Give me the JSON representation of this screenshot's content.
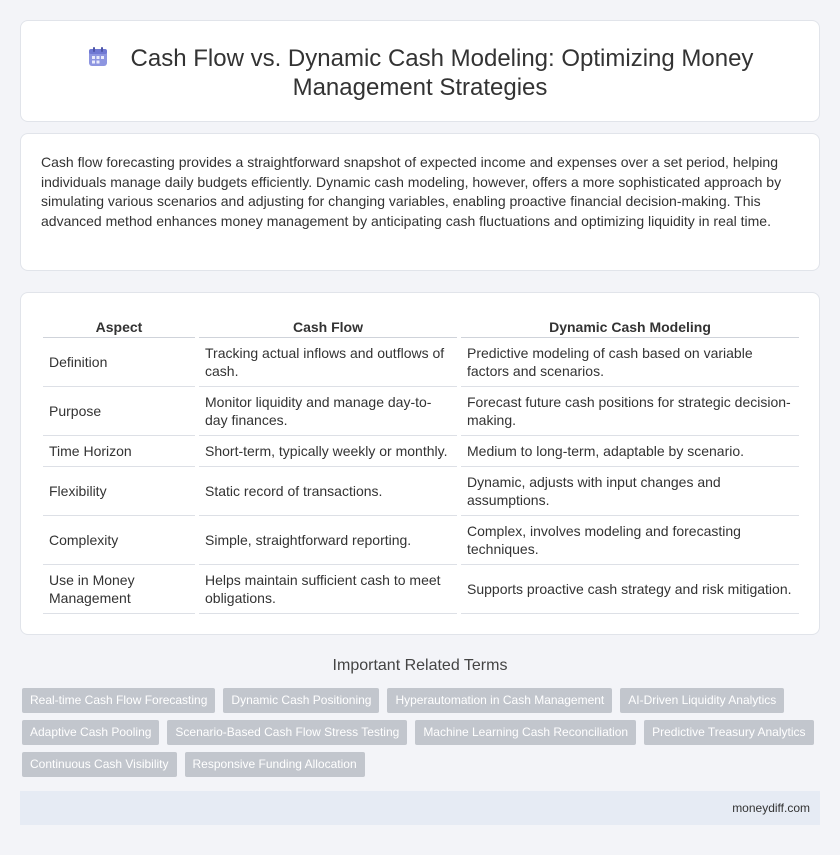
{
  "header": {
    "title": "Cash Flow vs. Dynamic Cash Modeling: Optimizing Money Management Strategies",
    "icon": "calendar-icon",
    "icon_color": "#7b83d8"
  },
  "intro": "Cash flow forecasting provides a straightforward snapshot of expected income and expenses over a set period, helping individuals manage daily budgets efficiently. Dynamic cash modeling, however, offers a more sophisticated approach by simulating various scenarios and adjusting for changing variables, enabling proactive financial decision-making. This advanced method enhances money management by anticipating cash fluctuations and optimizing liquidity in real time.",
  "table": {
    "headers": [
      "Aspect",
      "Cash Flow",
      "Dynamic Cash Modeling"
    ],
    "rows": [
      [
        "Definition",
        "Tracking actual inflows and outflows of cash.",
        "Predictive modeling of cash based on variable factors and scenarios."
      ],
      [
        "Purpose",
        "Monitor liquidity and manage day-to-day finances.",
        "Forecast future cash positions for strategic decision-making."
      ],
      [
        "Time Horizon",
        "Short-term, typically weekly or monthly.",
        "Medium to long-term, adaptable by scenario."
      ],
      [
        "Flexibility",
        "Static record of transactions.",
        "Dynamic, adjusts with input changes and assumptions."
      ],
      [
        "Complexity",
        "Simple, straightforward reporting.",
        "Complex, involves modeling and forecasting techniques."
      ],
      [
        "Use in Money Management",
        "Helps maintain sufficient cash to meet obligations.",
        "Supports proactive cash strategy and risk mitigation."
      ]
    ]
  },
  "related": {
    "heading": "Important Related Terms",
    "tags": [
      "Real-time Cash Flow Forecasting",
      "Dynamic Cash Positioning",
      "Hyperautomation in Cash Management",
      "AI-Driven Liquidity Analytics",
      "Adaptive Cash Pooling",
      "Scenario-Based Cash Flow Stress Testing",
      "Machine Learning Cash Reconciliation",
      "Predictive Treasury Analytics",
      "Continuous Cash Visibility",
      "Responsive Funding Allocation"
    ]
  },
  "footer": {
    "site": "moneydiff.com"
  }
}
